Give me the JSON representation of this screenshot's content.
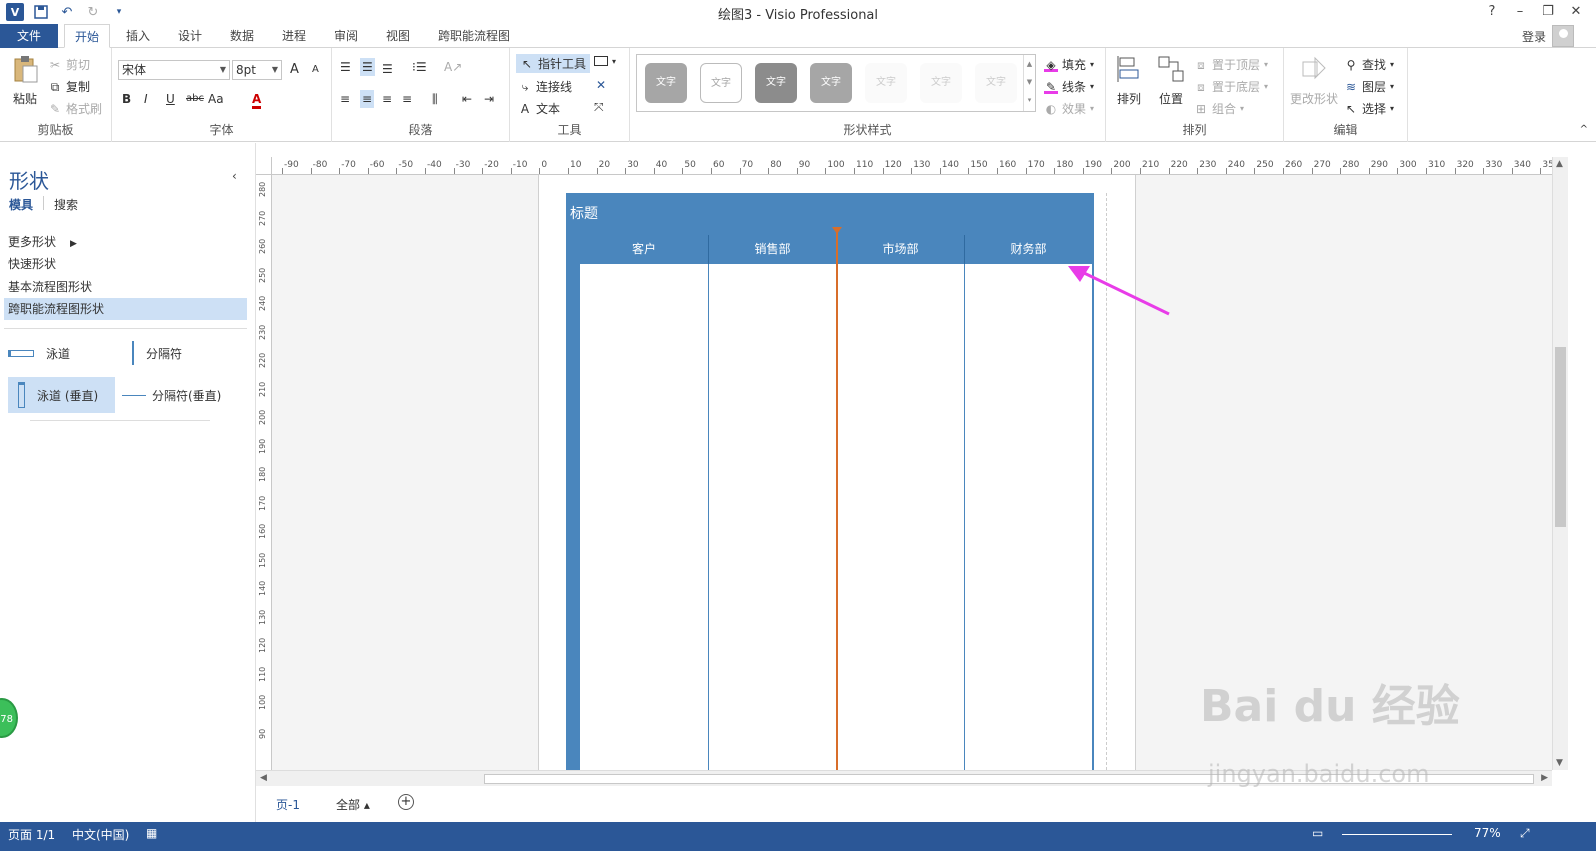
{
  "window": {
    "title": "绘图3 - Visio Professional",
    "app_logo": "V",
    "help": "?",
    "minimize": "–",
    "restore": "❐",
    "close": "✕"
  },
  "tabs": {
    "file": "文件",
    "items": [
      "开始",
      "插入",
      "设计",
      "数据",
      "进程",
      "审阅",
      "视图",
      "跨职能流程图"
    ],
    "active": "开始",
    "login": "登录"
  },
  "ribbon": {
    "clipboard": {
      "paste": "粘贴",
      "cut": "剪切",
      "copy": "复制",
      "format_painter": "格式刷",
      "label": "剪贴板"
    },
    "font": {
      "family": "宋体",
      "size": "8pt",
      "grow": "A",
      "shrink": "A",
      "bold": "B",
      "italic": "I",
      "underline": "U",
      "strike": "abc",
      "case": "Aa",
      "color": "A",
      "label": "字体"
    },
    "paragraph": {
      "label": "段落"
    },
    "tools": {
      "pointer": "指针工具",
      "connector": "连接线",
      "text": "文本",
      "label": "工具"
    },
    "shape_styles": {
      "swatch_text": "文字",
      "fill": "填充",
      "line": "线条",
      "effects": "效果",
      "label": "形状样式"
    },
    "arrange": {
      "align": "排列",
      "position": "位置",
      "bring_front": "置于顶层",
      "send_back": "置于底层",
      "group": "组合",
      "label": "排列"
    },
    "editing": {
      "change_shape": "更改形状",
      "find": "查找",
      "layers": "图层",
      "select": "选择",
      "label": "编辑"
    }
  },
  "shapes_pane": {
    "title": "形状",
    "tabs": [
      "模具",
      "搜索"
    ],
    "more_shapes": "更多形状",
    "quick_shapes": "快速形状",
    "basic_flowchart": "基本流程图形状",
    "cff_shapes": "跨职能流程图形状",
    "shapes": {
      "swimlane": "泳道",
      "separator": "分隔符",
      "swimlane_vertical": "泳道 (垂直)",
      "separator_vertical": "分隔符(垂直)"
    }
  },
  "ruler": {
    "h_ticks": [
      "-90",
      "-80",
      "-70",
      "-60",
      "-50",
      "-40",
      "-30",
      "-20",
      "-10",
      "0",
      "10",
      "20",
      "30",
      "40",
      "50",
      "60",
      "70",
      "80",
      "90",
      "100",
      "110",
      "120",
      "130",
      "140",
      "150",
      "160",
      "170",
      "180",
      "190",
      "200",
      "210",
      "220",
      "230",
      "240",
      "250",
      "260",
      "270",
      "280",
      "290",
      "300",
      "310",
      "320",
      "330",
      "340",
      "350"
    ],
    "v_ticks": [
      "280",
      "270",
      "260",
      "250",
      "240",
      "230",
      "220",
      "210",
      "200",
      "190",
      "180",
      "170",
      "160",
      "150",
      "140",
      "130",
      "120",
      "110",
      "100",
      "90"
    ]
  },
  "diagram": {
    "title": "标题",
    "lanes": [
      "客户",
      "销售部",
      "市场部",
      "财务部"
    ]
  },
  "page_tabs": {
    "page1": "页-1",
    "all": "全部 ▴",
    "add": "+"
  },
  "status": {
    "page": "页面 1/1",
    "language": "中文(中国)",
    "zoom": "77%"
  },
  "overlay": {
    "badge": "78",
    "watermark": "Bai du 经验",
    "watermark_sub": "jingyan.baidu.com"
  },
  "colors": {
    "brand": "#2b5797",
    "lane_header": "#4a86bd",
    "separator": "#d86e2a",
    "annotation_arrow": "#e83ce8"
  }
}
